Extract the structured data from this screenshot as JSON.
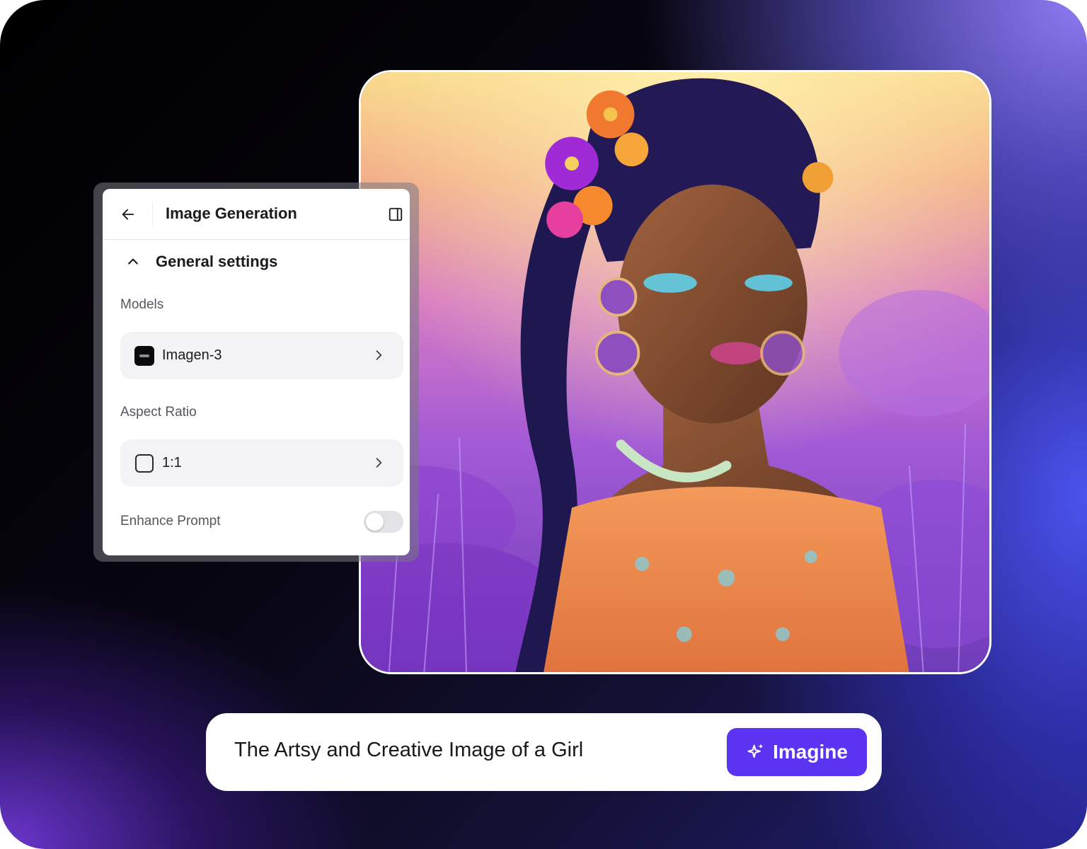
{
  "panel": {
    "title": "Image Generation",
    "back_icon": "arrow-left-icon",
    "sidebar_icon": "sidebar-toggle-icon",
    "section": {
      "title": "General settings",
      "expanded": true
    },
    "models": {
      "label": "Models",
      "value": "Imagen-3"
    },
    "aspect_ratio": {
      "label": "Aspect Ratio",
      "value": "1:1"
    },
    "enhance_prompt": {
      "label": "Enhance Prompt",
      "enabled": false
    }
  },
  "prompt": {
    "text": "The Artsy and Creative Image of a Girl",
    "button_label": "Imagine",
    "button_icon": "sparkle-icon"
  },
  "colors": {
    "accent": "#5b34f2",
    "toggle_off": "#e4e4e8"
  }
}
